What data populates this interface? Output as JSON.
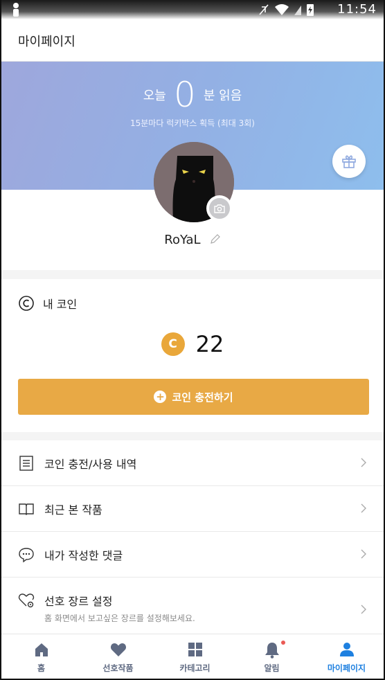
{
  "status_bar": {
    "time": "11:54"
  },
  "app_bar": {
    "title": "마이페이지"
  },
  "banner": {
    "today_label": "오늘",
    "minutes": "0",
    "unit_label": "분 읽음",
    "subtitle": "15분마다 럭키박스 획득 (최대 3회)",
    "gradient_start": "#9ea7dc",
    "gradient_end": "#8ebeed"
  },
  "profile": {
    "nickname": "RoYaL"
  },
  "coin": {
    "section_label": "내 코인",
    "coin_symbol": "C",
    "amount": "22",
    "charge_button": "코인 충전하기",
    "accent": "#e8a945"
  },
  "menu": [
    {
      "icon": "list-icon",
      "label": "코인 충전/사용 내역"
    },
    {
      "icon": "book-icon",
      "label": "최근 본 작품"
    },
    {
      "icon": "chat-bubble-icon",
      "label": "내가 작성한 댓글"
    },
    {
      "icon": "heart-settings-icon",
      "label": "선호 장르 설정",
      "sub": "홈 화면에서 보고싶은 장르를 설정해보세요."
    }
  ],
  "bottom_nav": [
    {
      "icon": "home-icon",
      "label": "홈"
    },
    {
      "icon": "heart-icon",
      "label": "선호작품"
    },
    {
      "icon": "grid-icon",
      "label": "카테고리"
    },
    {
      "icon": "bell-icon",
      "label": "알림"
    },
    {
      "icon": "person-icon",
      "label": "마이페이지",
      "active": true
    }
  ],
  "colors": {
    "nav_inactive": "#5f6a82",
    "nav_active": "#1e80e0",
    "notification_dot": "#ea5a55"
  }
}
